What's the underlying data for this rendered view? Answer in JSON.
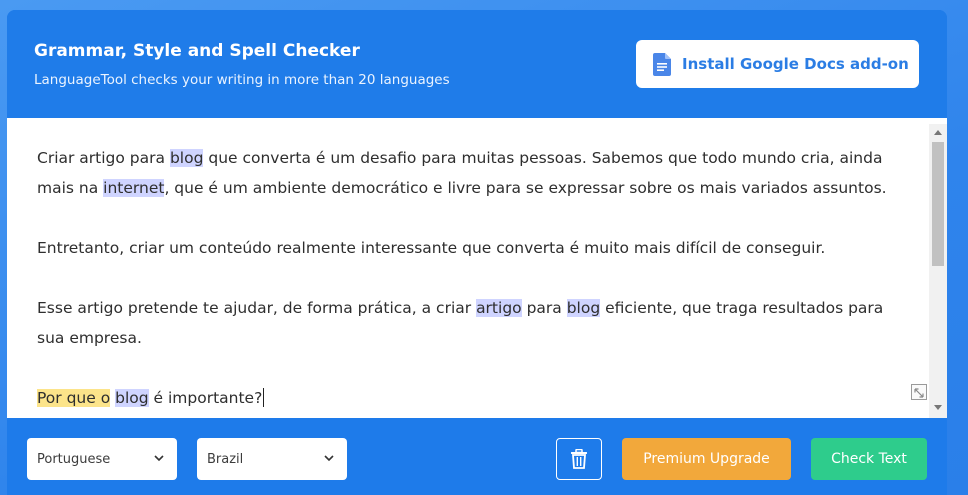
{
  "header": {
    "title": "Grammar, Style and Spell Checker",
    "subtitle": "LanguageTool checks your writing in more than 20 languages",
    "gdocs_button_label": "Install Google Docs add-on",
    "gdocs_icon": "google-docs-icon"
  },
  "editor": {
    "p1": {
      "t1": "Criar artigo para ",
      "h1": "blog",
      "t2": " que converta é um desafio para muitas pessoas. Sabemos que todo mundo cria, ainda mais na ",
      "h2": "internet",
      "t3": ", que é um ambiente democrático e livre para se expressar sobre os mais variados assuntos."
    },
    "p2": "Entretanto, criar um conteúdo realmente interessante que converta é muito mais difícil de conseguir.",
    "p3": {
      "t1": "Esse artigo pretende te ajudar, de forma prática, a criar ",
      "h1": "artigo",
      "t2": " para ",
      "h2": "blog",
      "t3": " eficiente, que traga resultados para sua empresa."
    },
    "p4": {
      "h1": "Por que o",
      "t1": " ",
      "h2": "blog",
      "t2": " é importante?"
    }
  },
  "footer": {
    "language_select": "Portuguese",
    "variant_select": "Brazil",
    "trash_icon": "trash-icon",
    "premium_label": "Premium Upgrade",
    "check_label": "Check Text"
  },
  "colors": {
    "header_bg": "#1f7ce9",
    "highlight_spelling": "#cfd4ff",
    "highlight_style": "#fce48a",
    "premium": "#f2a83b",
    "check": "#2ecc8c"
  }
}
